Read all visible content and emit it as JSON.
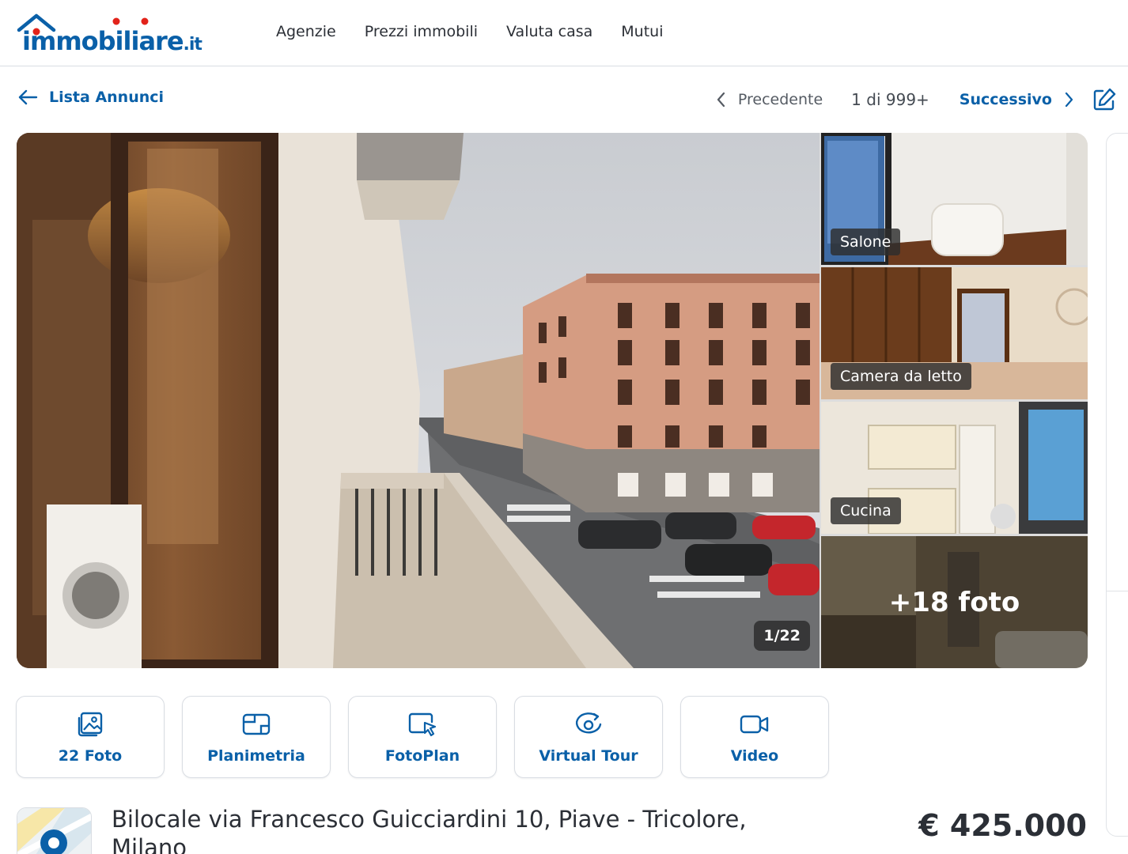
{
  "header": {
    "logo_main": "immobiliare",
    "logo_tld": ".it",
    "nav": [
      {
        "label": "Agenzie"
      },
      {
        "label": "Prezzi immobili"
      },
      {
        "label": "Valuta casa"
      },
      {
        "label": "Mutui"
      }
    ]
  },
  "pager": {
    "back_label": "Lista Annunci",
    "prev_label": "Precedente",
    "count": "1 di 999+",
    "next_label": "Successivo"
  },
  "gallery": {
    "counter": "1/22",
    "thumbs": [
      {
        "label": "Salone"
      },
      {
        "label": "Camera da letto"
      },
      {
        "label": "Cucina"
      }
    ],
    "more_label": "+18 foto"
  },
  "media_buttons": [
    {
      "label": "22 Foto",
      "icon": "photos-icon"
    },
    {
      "label": "Planimetria",
      "icon": "floorplan-icon"
    },
    {
      "label": "FotoPlan",
      "icon": "fotoplan-icon"
    },
    {
      "label": "Virtual Tour",
      "icon": "virtual-tour-icon"
    },
    {
      "label": "Video",
      "icon": "video-icon"
    }
  ],
  "listing": {
    "title": "Bilocale via Francesco Guicciardini 10, Piave - Tricolore, Milano",
    "price": "€ 425.000"
  },
  "colors": {
    "brand": "#0a60a8",
    "logo_dot": "#e2231a"
  }
}
